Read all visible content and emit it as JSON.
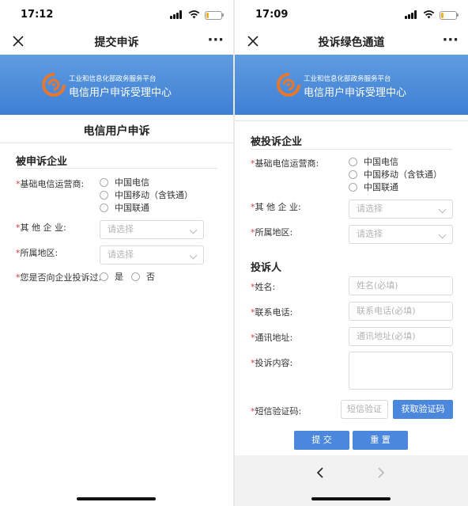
{
  "left": {
    "status_time": "17:12",
    "nav_title": "提交申诉",
    "more_label": "···",
    "banner_sub": "工业和信息化部政务服务平台",
    "banner_main": "电信用户申诉受理中心",
    "page_title": "电信用户申诉",
    "section_title": "被申诉企业",
    "carrier_label": "基础电信运营商:",
    "carrier_options": [
      "中国电信",
      "中国移动（含铁通）",
      "中国联通"
    ],
    "other_label": "其 他 企 业:",
    "other_placeholder": "请选择",
    "region_label": "所属地区:",
    "region_placeholder": "请选择",
    "complained_label": "您是否向企业投诉过:",
    "yes_label": "是",
    "no_label": "否",
    "required_mark": "*"
  },
  "right": {
    "status_time": "17:09",
    "nav_title": "投诉绿色通道",
    "more_label": "···",
    "banner_sub": "工业和信息化部政务服务平台",
    "banner_main": "电信用户申诉受理中心",
    "section1_title": "被投诉企业",
    "carrier_label": "基础电信运营商:",
    "carrier_options": [
      "中国电信",
      "中国移动（含铁通）",
      "中国联通"
    ],
    "other_label": "其 他 企 业:",
    "other_placeholder": "请选择",
    "region_label": "所属地区:",
    "region_placeholder": "请选择",
    "section2_title": "投诉人",
    "name_label": "姓名:",
    "name_placeholder": "姓名(必填)",
    "phone_label": "联系电话:",
    "phone_placeholder": "联系电话(必填)",
    "address_label": "通讯地址:",
    "address_placeholder": "通讯地址(必填)",
    "content_label": "投诉内容:",
    "sms_label": "短信验证码:",
    "sms_placeholder": "短信验证",
    "get_code_label": "获取验证码",
    "submit_label": "提 交",
    "reset_label": "重 置",
    "required_mark": "*"
  },
  "colors": {
    "accent": "#4a87dd",
    "banner_top": "#5f9ce0",
    "banner_bottom": "#3f7fd4",
    "required": "#e0393e"
  }
}
